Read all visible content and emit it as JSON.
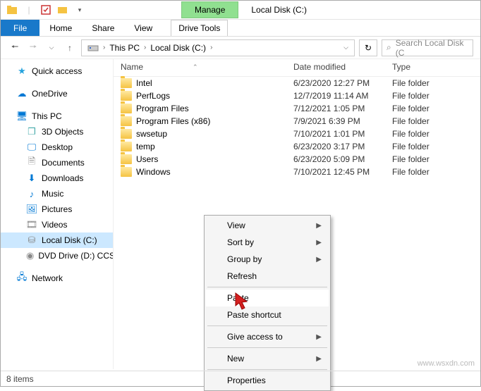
{
  "title": "Local Disk (C:)",
  "manage_label": "Manage",
  "drive_tools_label": "Drive Tools",
  "ribbon": {
    "file": "File",
    "home": "Home",
    "share": "Share",
    "view": "View"
  },
  "breadcrumb": {
    "pc": "This PC",
    "drive": "Local Disk (C:)"
  },
  "search_placeholder": "Search Local Disk (C",
  "columns": {
    "name": "Name",
    "date": "Date modified",
    "type": "Type"
  },
  "nav": {
    "quick": "Quick access",
    "onedrive": "OneDrive",
    "thispc": "This PC",
    "objects": "3D Objects",
    "desktop": "Desktop",
    "documents": "Documents",
    "downloads": "Downloads",
    "music": "Music",
    "pictures": "Pictures",
    "videos": "Videos",
    "localdisk": "Local Disk (C:)",
    "dvd": "DVD Drive (D:) CCSA",
    "network": "Network"
  },
  "rows": [
    {
      "name": "Intel",
      "date": "6/23/2020 12:27 PM",
      "type": "File folder"
    },
    {
      "name": "PerfLogs",
      "date": "12/7/2019 11:14 AM",
      "type": "File folder"
    },
    {
      "name": "Program Files",
      "date": "7/12/2021 1:05 PM",
      "type": "File folder"
    },
    {
      "name": "Program Files (x86)",
      "date": "7/9/2021 6:39 PM",
      "type": "File folder"
    },
    {
      "name": "swsetup",
      "date": "7/10/2021 1:01 PM",
      "type": "File folder"
    },
    {
      "name": "temp",
      "date": "6/23/2020 3:17 PM",
      "type": "File folder"
    },
    {
      "name": "Users",
      "date": "6/23/2020 5:09 PM",
      "type": "File folder"
    },
    {
      "name": "Windows",
      "date": "7/10/2021 12:45 PM",
      "type": "File folder"
    }
  ],
  "ctx": {
    "view": "View",
    "sort": "Sort by",
    "group": "Group by",
    "refresh": "Refresh",
    "paste": "Paste",
    "paste_shortcut": "Paste shortcut",
    "give_access": "Give access to",
    "new": "New",
    "properties": "Properties"
  },
  "status": "8 items",
  "watermark": "www.wsxdn.com"
}
